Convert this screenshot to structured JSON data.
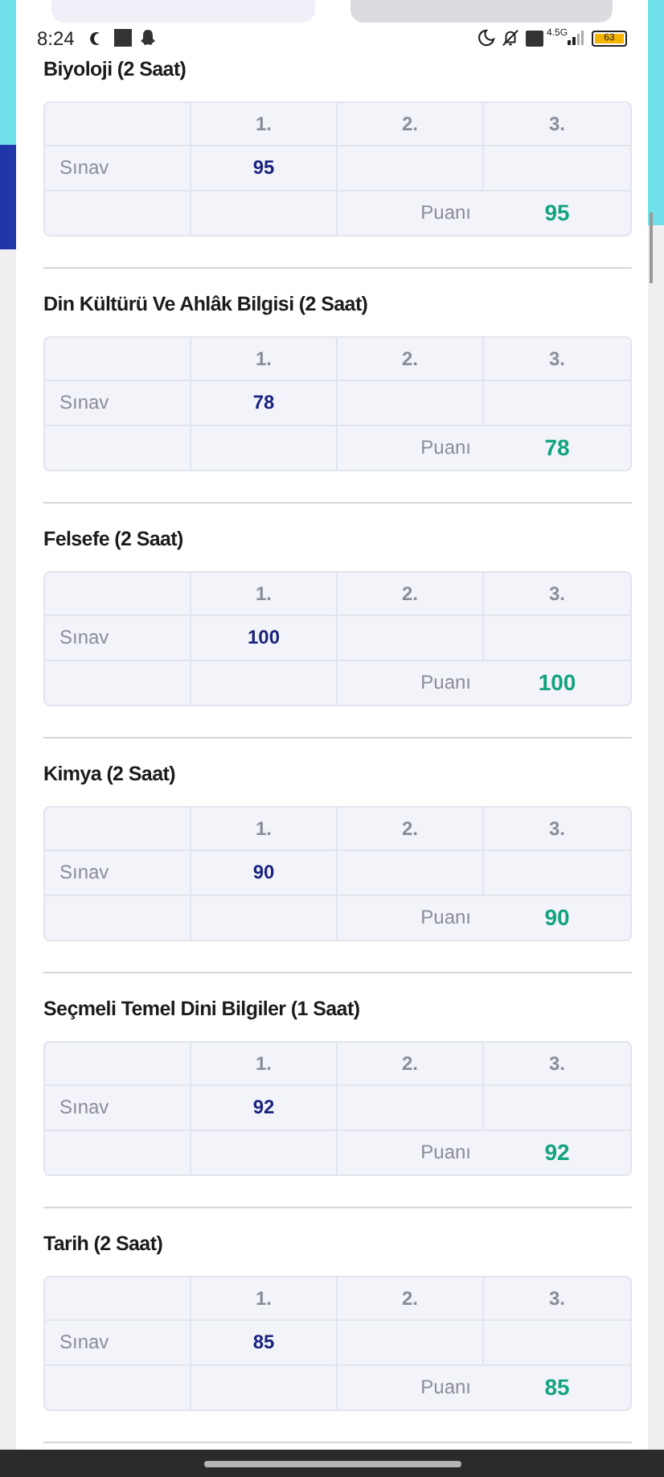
{
  "status_bar": {
    "time": "8:24",
    "network": "4.5G",
    "battery": "63"
  },
  "subjects": [
    {
      "title": "Biyoloji (2 Saat)",
      "columns": [
        "1.",
        "2.",
        "3."
      ],
      "row_label": "Sınav",
      "exam_scores": [
        "95"
      ],
      "average_label": "Puanı",
      "average": "95"
    },
    {
      "title": "Din Kültürü Ve Ahlâk Bilgisi (2 Saat)",
      "columns": [
        "1.",
        "2.",
        "3."
      ],
      "row_label": "Sınav",
      "exam_scores": [
        "78"
      ],
      "average_label": "Puanı",
      "average": "78"
    },
    {
      "title": "Felsefe (2 Saat)",
      "columns": [
        "1.",
        "2.",
        "3."
      ],
      "row_label": "Sınav",
      "exam_scores": [
        "100"
      ],
      "average_label": "Puanı",
      "average": "100"
    },
    {
      "title": "Kimya (2 Saat)",
      "columns": [
        "1.",
        "2.",
        "3."
      ],
      "row_label": "Sınav",
      "exam_scores": [
        "90"
      ],
      "average_label": "Puanı",
      "average": "90"
    },
    {
      "title": "Seçmeli Temel Dini Bilgiler (1 Saat)",
      "columns": [
        "1.",
        "2.",
        "3."
      ],
      "row_label": "Sınav",
      "exam_scores": [
        "92"
      ],
      "average_label": "Puanı",
      "average": "92"
    },
    {
      "title": "Tarih (2 Saat)",
      "columns": [
        "1.",
        "2.",
        "3."
      ],
      "row_label": "Sınav",
      "exam_scores": [
        "85"
      ],
      "average_label": "Puanı",
      "average": "85"
    }
  ]
}
